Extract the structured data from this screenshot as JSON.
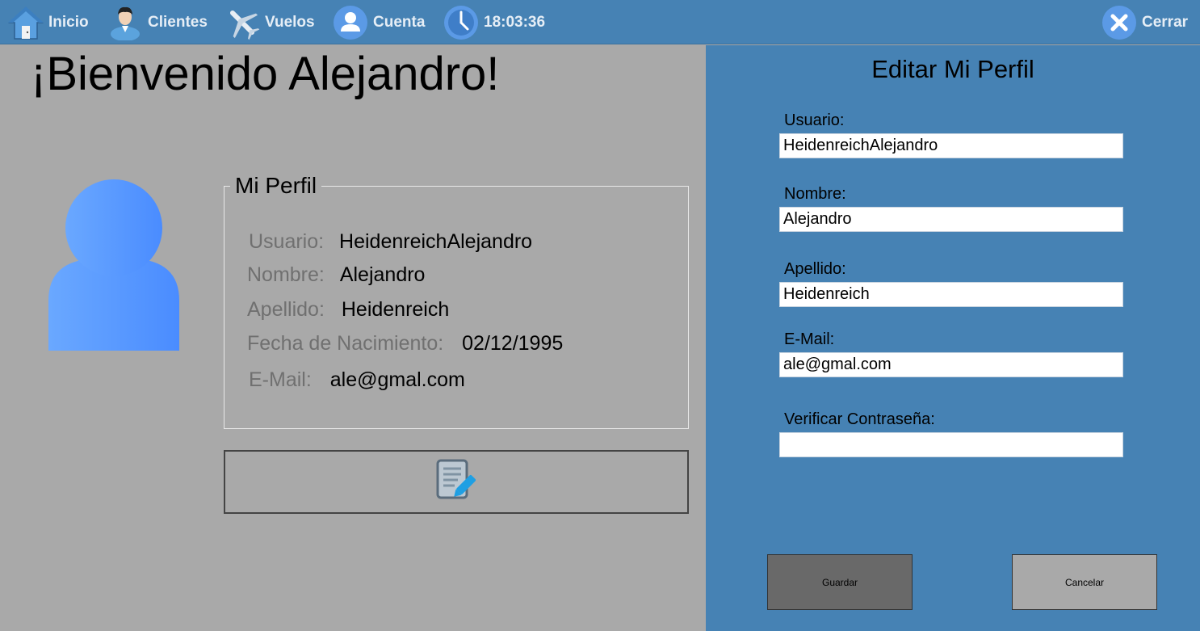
{
  "nav": {
    "inicio": "Inicio",
    "clientes": "Clientes",
    "vuelos": "Vuelos",
    "cuenta": "Cuenta",
    "clock": "18:03:36",
    "cerrar": "Cerrar"
  },
  "welcome": "¡Bienvenido Alejandro!",
  "profile": {
    "legend": "Mi Perfil",
    "rows": [
      {
        "label": "Usuario:",
        "value": "HeidenreichAlejandro"
      },
      {
        "label": "Nombre:",
        "value": "Alejandro"
      },
      {
        "label": "Apellido:",
        "value": "Heidenreich"
      },
      {
        "label": "Fecha de Nacimiento:",
        "value": "02/12/1995"
      },
      {
        "label": "E-Mail:",
        "value": "ale@gmal.com"
      }
    ]
  },
  "edit": {
    "title": "Editar Mi Perfil",
    "fields": [
      {
        "label": "Usuario:",
        "value": "HeidenreichAlejandro"
      },
      {
        "label": "Nombre:",
        "value": "Alejandro"
      },
      {
        "label": "Apellido:",
        "value": "Heidenreich"
      },
      {
        "label": "E-Mail:",
        "value": "ale@gmal.com"
      },
      {
        "label": "Verificar Contraseña:",
        "value": ""
      }
    ],
    "save": "Guardar",
    "cancel": "Cancelar"
  },
  "icons": {
    "home": "home-icon",
    "clients": "person-icon",
    "flights": "airplane-icon",
    "account": "account-icon",
    "clock": "clock-icon",
    "close": "close-icon",
    "avatar": "user-avatar-icon",
    "edit": "edit-document-icon"
  },
  "colors": {
    "topbar": "#4682b4",
    "panel": "#4682b4",
    "background": "#a9a9a9",
    "save_button": "#696969"
  }
}
